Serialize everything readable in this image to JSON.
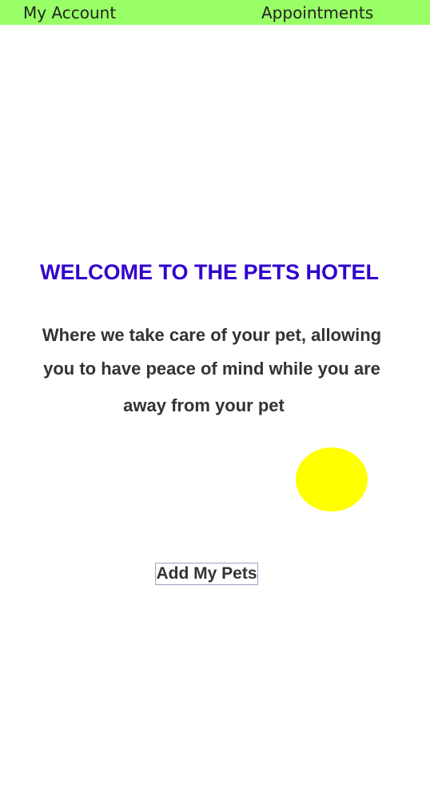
{
  "nav": {
    "my_account": "My Account",
    "appointments": "Appointments",
    "background_color": "#99ff66"
  },
  "main": {
    "title": "WELCOME TO THE PETS HOTEL",
    "title_color": "#3300cc",
    "tagline_lines": [
      "Where we take care of your pet, allowing",
      "you to have peace of mind while you are",
      "away from your pet"
    ],
    "sun_color": "#ffff00",
    "add_button_label": "Add My Pets"
  }
}
